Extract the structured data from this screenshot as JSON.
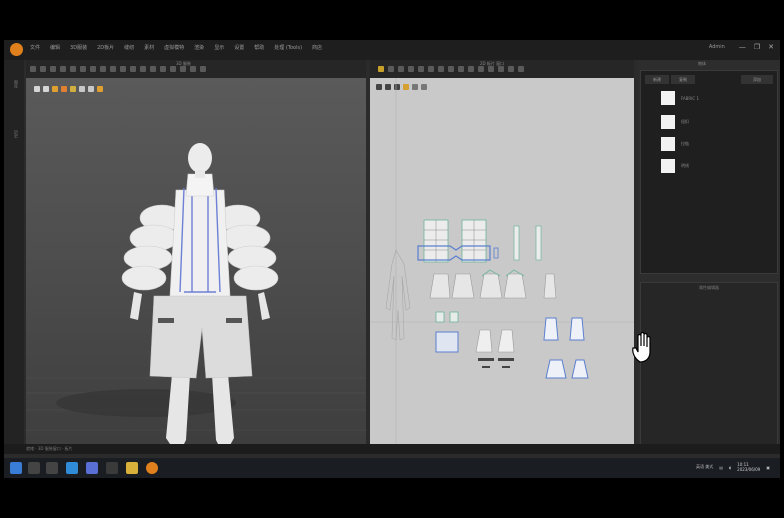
{
  "menubar": {
    "menus": [
      "文件",
      "编辑",
      "3D服装",
      "2D板片",
      "缝纫",
      "素材",
      "虚拟模特",
      "渲染",
      "显示",
      "设置",
      "帮助",
      "处理 (Tools)",
      "商店"
    ],
    "user_label": "Admin",
    "window_controls": [
      "—",
      "❐",
      "✕"
    ]
  },
  "left_strip": {
    "tabs": [
      "图库",
      "历史"
    ]
  },
  "windows": {
    "title_3d": "3D 服装",
    "title_2d": "2D 板片 窗口",
    "title_obj": "物体"
  },
  "object_browser": {
    "buttons": [
      "新建",
      "复制",
      "添加"
    ],
    "items": [
      {
        "label": "FABRIC 1",
        "color": "#f2f2f2"
      },
      {
        "label": "纽扣",
        "color": "#f2f2f2"
      },
      {
        "label": "拉链",
        "color": "#f2f2f2"
      },
      {
        "label": "明线",
        "color": "#f2f2f2"
      }
    ]
  },
  "property_editor": {
    "title": "属性编辑器"
  },
  "statusbar": {
    "left_text": "就绪 · 3D 服装窗口 · 板片"
  },
  "taskbar": {
    "icons": [
      "windows-start-icon",
      "search-icon",
      "task-view-icon",
      "edge-browser-icon",
      "copilot-icon",
      "store-icon",
      "file-explorer-icon",
      "clo3d-app-icon"
    ],
    "tray_text": "英语 美式",
    "time": "10:11",
    "date": "2023/06/09"
  },
  "colors": {
    "accent_orange": "#e0801c",
    "pattern_outline_blue": "#5b7fd0",
    "pattern_outline_green": "#6fb59a",
    "pattern_canvas": "#c9c9c9"
  }
}
